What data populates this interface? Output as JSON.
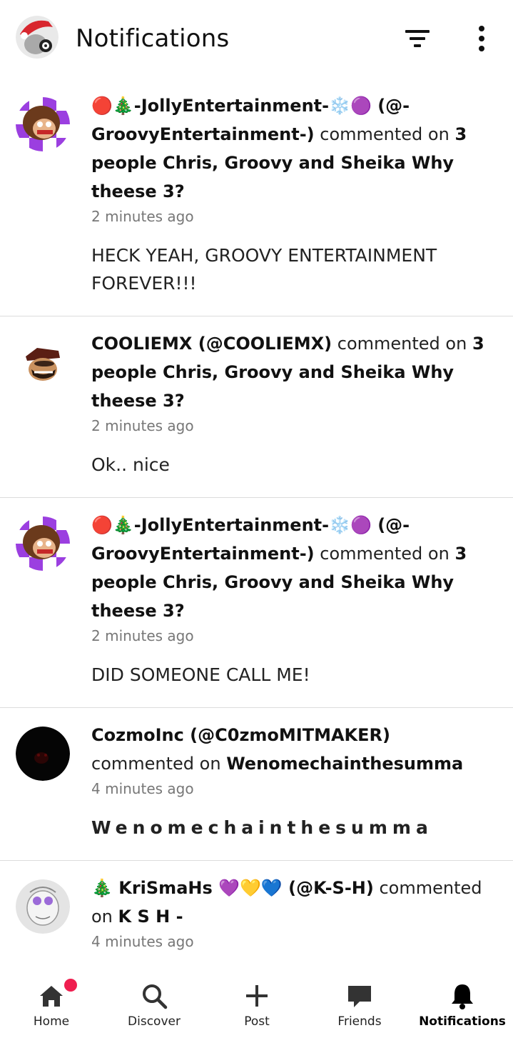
{
  "header": {
    "title": "Notifications"
  },
  "colors": {
    "accent": "#ef1e4f",
    "text": "#111111",
    "muted": "#777777",
    "divider": "#dcdcdc"
  },
  "notifications": [
    {
      "user": "🔴🎄-JollyEntertainment-❄️🟣 (@-GroovyEntertainment-)",
      "verb": " commented on ",
      "target": "3 people Chris, Groovy and Sheika Why theese 3?",
      "time": "2 minutes ago",
      "body": "HECK YEAH, GROOVY ENTERTAINMENT FOREVER!!!"
    },
    {
      "user": "COOLIEMX (@COOLIEMX)",
      "verb": " commented on ",
      "target": "3 people Chris, Groovy and Sheika Why theese 3?",
      "time": "2 minutes ago",
      "body": "Ok.. nice"
    },
    {
      "user": "🔴🎄-JollyEntertainment-❄️🟣 (@-GroovyEntertainment-)",
      "verb": " commented on ",
      "target": "3 people Chris, Groovy and Sheika Why theese 3?",
      "time": "2 minutes ago",
      "body": "DID SOMEONE CALL ME!"
    },
    {
      "user": "CozmoInc (@C0zmoMITMAKER)",
      "verb": " commented on ",
      "target": "Wenomechainthesumma",
      "time": "4 minutes ago",
      "body": "Wenomechainthesumma"
    },
    {
      "user": "🎄 KriSmaHs 💜💛💙 (@K-S-H)",
      "verb": " commented on ",
      "target": "K S H -",
      "time": "4 minutes ago",
      "body": ""
    }
  ],
  "nav": {
    "home": "Home",
    "discover": "Discover",
    "post": "Post",
    "friends": "Friends",
    "notifications": "Notifications"
  }
}
